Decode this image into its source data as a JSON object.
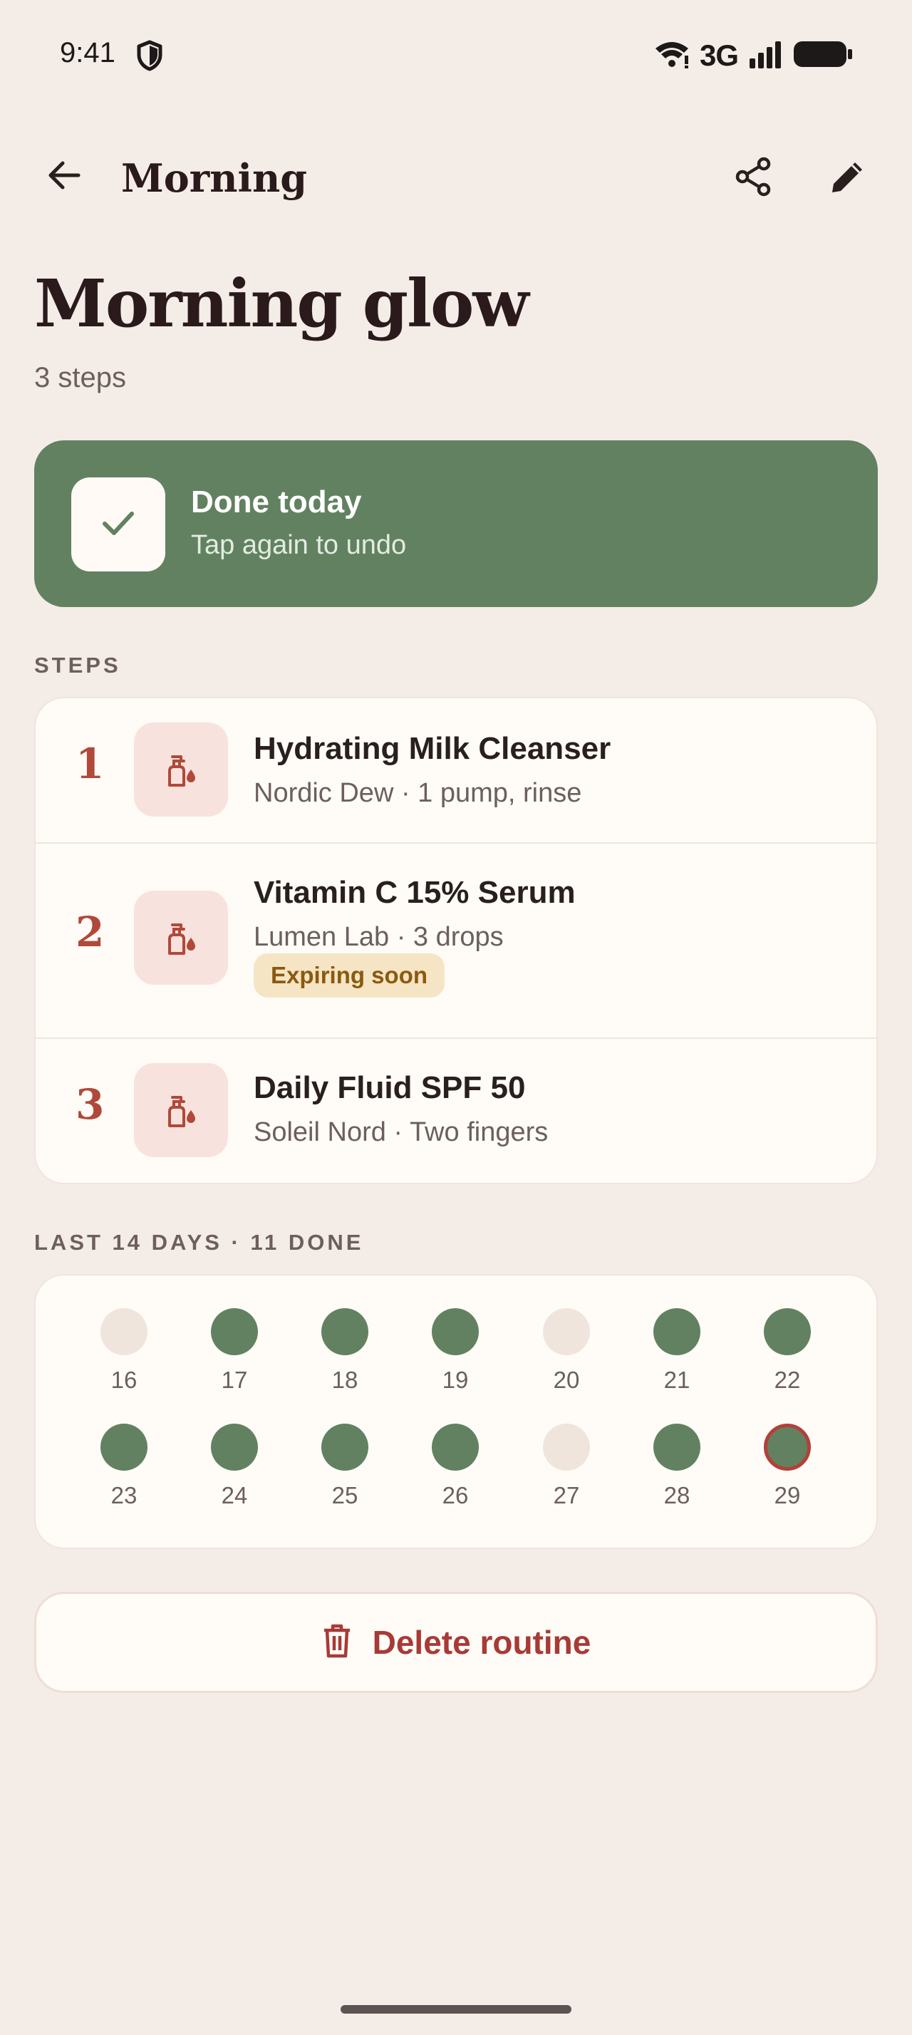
{
  "status_bar": {
    "time": "9:41",
    "network": "3G",
    "icons": [
      "shield-icon",
      "wifi-icon",
      "signal-icon",
      "battery-icon"
    ]
  },
  "app_bar": {
    "title": "Morning",
    "icons": [
      "back-arrow-icon",
      "share-icon",
      "edit-pencil-icon"
    ]
  },
  "header": {
    "title": "Morning glow",
    "subtitle": "3 steps"
  },
  "done_card": {
    "title": "Done today",
    "subtitle": "Tap again to undo",
    "icon": "checkmark-icon",
    "color": "#628160"
  },
  "steps_section": {
    "label": "STEPS",
    "steps": [
      {
        "number": "1",
        "name": "Hydrating Milk Cleanser",
        "meta": "Nordic Dew · 1 pump, rinse",
        "icon": "dropper-bottle-icon"
      },
      {
        "number": "2",
        "name": "Vitamin C 15% Serum",
        "meta": "Lumen Lab · 3 drops",
        "badge": "Expiring soon",
        "icon": "dropper-bottle-icon"
      },
      {
        "number": "3",
        "name": "Daily Fluid SPF 50",
        "meta": "Soleil Nord · Two fingers",
        "icon": "dropper-bottle-icon"
      }
    ]
  },
  "history_section": {
    "label": "LAST 14 DAYS · 11 DONE",
    "days": [
      {
        "day": "16",
        "done": false
      },
      {
        "day": "17",
        "done": true
      },
      {
        "day": "18",
        "done": true
      },
      {
        "day": "19",
        "done": true
      },
      {
        "day": "20",
        "done": false
      },
      {
        "day": "21",
        "done": true
      },
      {
        "day": "22",
        "done": true
      },
      {
        "day": "23",
        "done": true
      },
      {
        "day": "24",
        "done": true
      },
      {
        "day": "25",
        "done": true
      },
      {
        "day": "26",
        "done": true
      },
      {
        "day": "27",
        "done": false
      },
      {
        "day": "28",
        "done": true
      },
      {
        "day": "29",
        "done": true,
        "today": true
      }
    ],
    "colors": {
      "done": "#628160",
      "missed": "#efe5dc",
      "today_ring": "#b3403a"
    }
  },
  "delete_button": {
    "label": "Delete routine",
    "icon": "trash-icon",
    "color": "#a83a36"
  }
}
